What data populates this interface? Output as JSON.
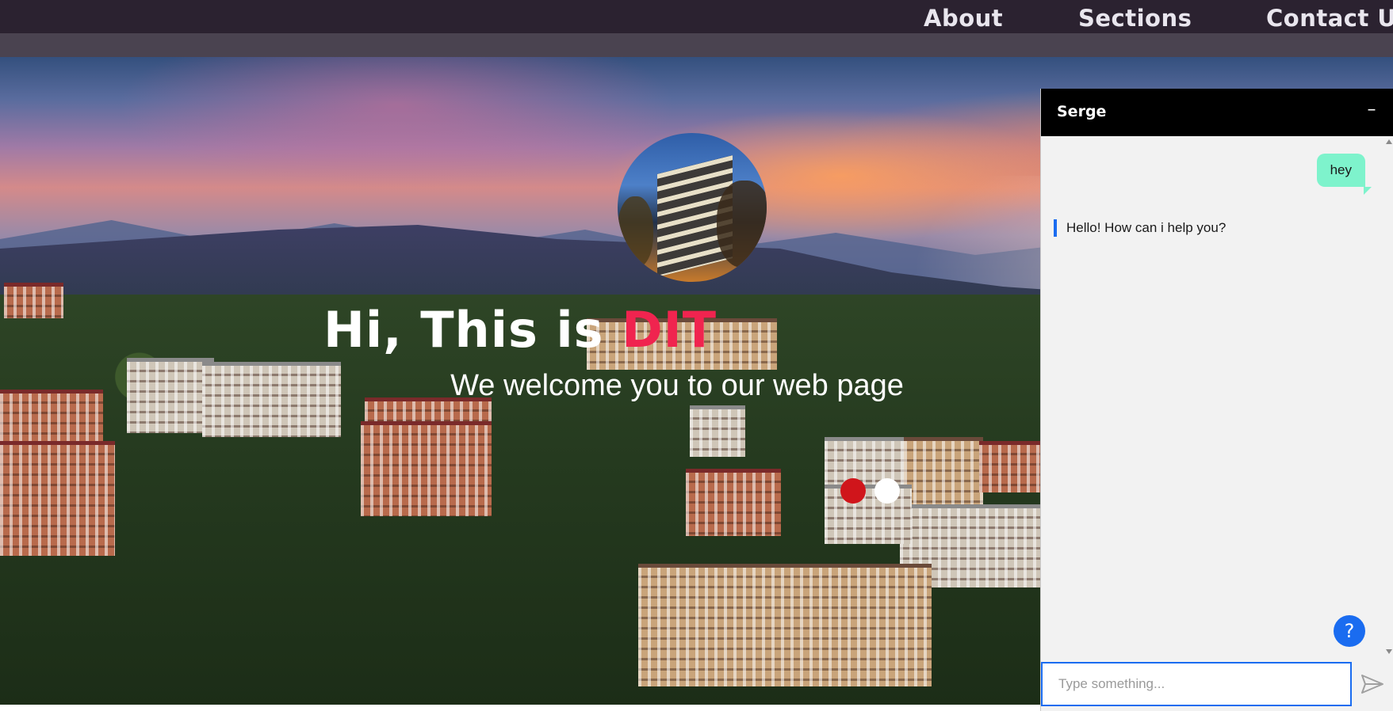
{
  "nav": {
    "items": [
      {
        "label": "About"
      },
      {
        "label": "Sections"
      },
      {
        "label": "Contact Us"
      }
    ]
  },
  "hero": {
    "title_prefix": "Hi, This is ",
    "title_accent": "DIT",
    "subtitle": "We welcome you to our web page",
    "accent_color": "#f0244f",
    "slider": {
      "count": 2,
      "active_index": 0
    }
  },
  "chat": {
    "title": "Serge",
    "minimize_symbol": "–",
    "messages": [
      {
        "from": "user",
        "text": "hey"
      },
      {
        "from": "bot",
        "text": "Hello! How can i help you?"
      }
    ],
    "help_symbol": "?",
    "input": {
      "value": "",
      "placeholder": "Type something..."
    },
    "colors": {
      "header": "#000000",
      "user_bubble": "#7ef3cc",
      "bot_accent": "#1a6cf0"
    }
  }
}
